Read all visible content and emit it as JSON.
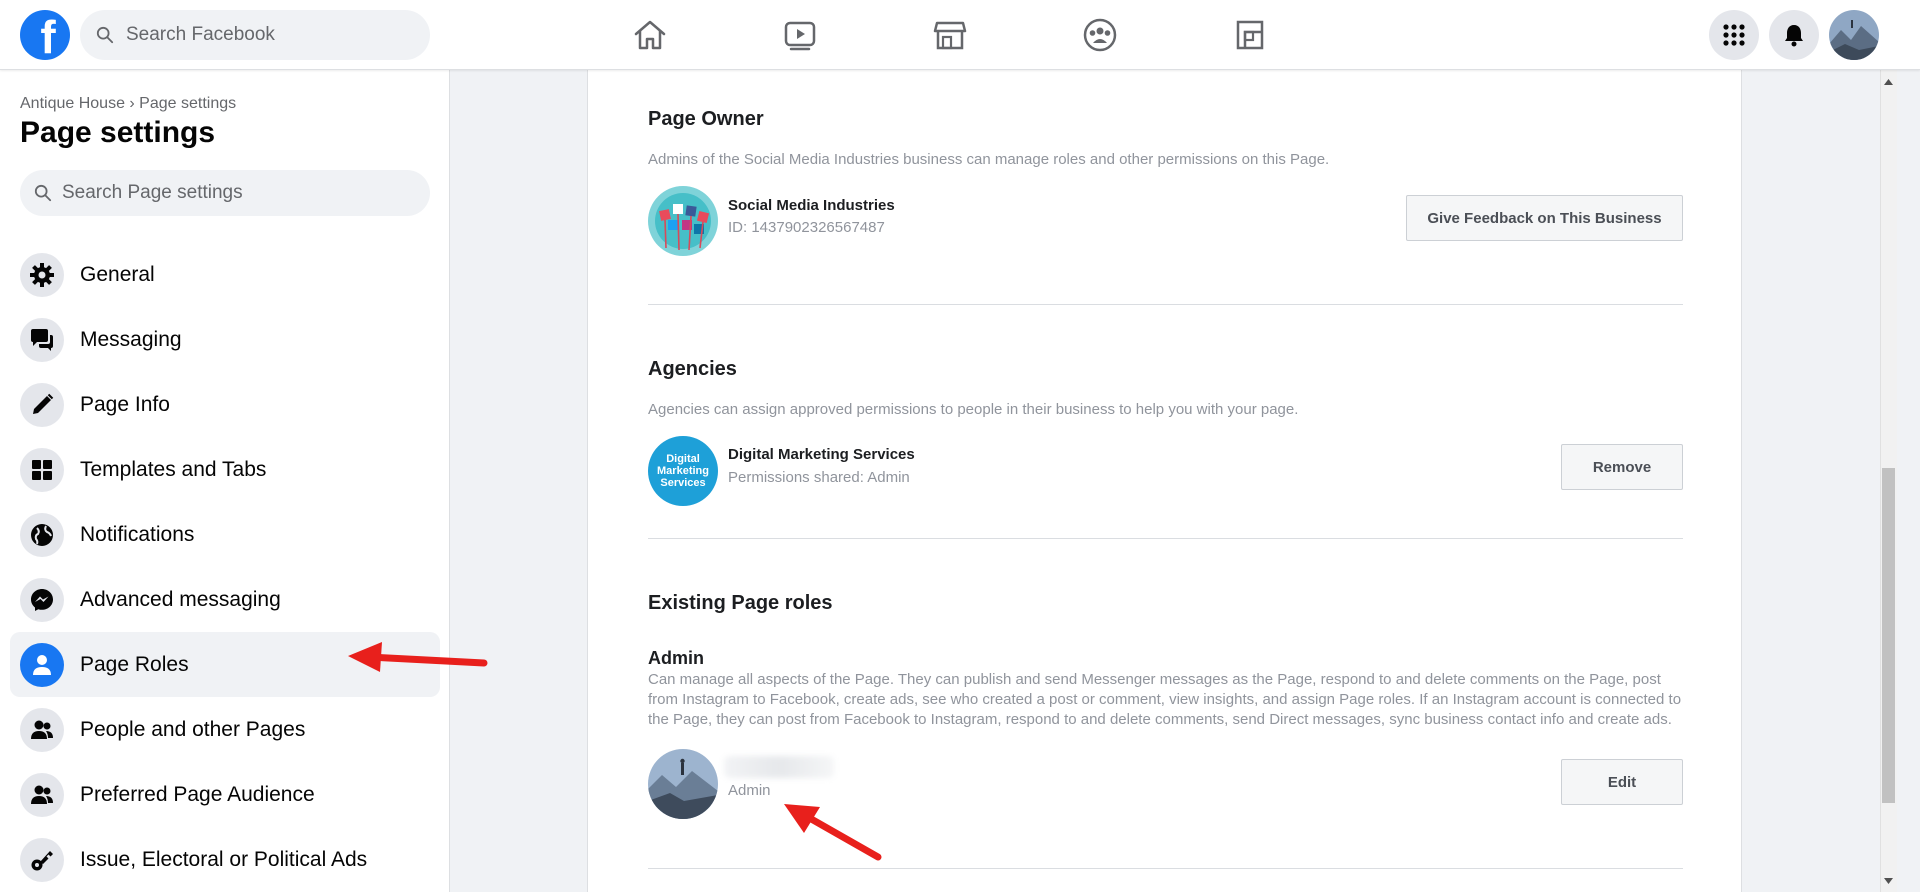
{
  "topbar": {
    "logo_letter": "f",
    "search_placeholder": "Search Facebook",
    "nav_icons": [
      "home-icon",
      "watch-icon",
      "marketplace-icon",
      "groups-icon",
      "gaming-icon"
    ],
    "right_icons": [
      "menu-grid-icon",
      "notifications-icon"
    ]
  },
  "sidebar": {
    "breadcrumb": "Antique House › Page settings",
    "title": "Page settings",
    "search_placeholder": "Search Page settings",
    "items": [
      {
        "label": "General",
        "icon": "gear-icon"
      },
      {
        "label": "Messaging",
        "icon": "chat-bubbles-icon"
      },
      {
        "label": "Page Info",
        "icon": "pencil-icon"
      },
      {
        "label": "Templates and Tabs",
        "icon": "grid-icon"
      },
      {
        "label": "Notifications",
        "icon": "globe-icon"
      },
      {
        "label": "Advanced messaging",
        "icon": "messenger-icon"
      },
      {
        "label": "Page Roles",
        "icon": "person-icon",
        "active": true
      },
      {
        "label": "People and other Pages",
        "icon": "people-icon"
      },
      {
        "label": "Preferred Page Audience",
        "icon": "people-icon"
      },
      {
        "label": "Issue, Electoral or Political Ads",
        "icon": "key-icon"
      }
    ]
  },
  "main": {
    "page_owner": {
      "title": "Page Owner",
      "description": "Admins of the Social Media Industries business can manage roles and other permissions on this Page.",
      "name": "Social Media Industries",
      "id_text": "ID: 1437902326567487",
      "button": "Give Feedback on This Business"
    },
    "agencies": {
      "title": "Agencies",
      "description": "Agencies can assign approved permissions to people in their business to help you with your page.",
      "name": "Digital Marketing Services",
      "avatar_text": "Digital Marketing Services",
      "sub": "Permissions shared: Admin",
      "button": "Remove"
    },
    "roles": {
      "title": "Existing Page roles",
      "role_title": "Admin",
      "role_description_1": "Can manage all aspects of the Page. They can publish and send Messenger messages as the Page, respond to and delete comments on the Page, post",
      "role_description_2": "from Instagram to Facebook, create ads, see who created a post or comment, view insights, and assign Page roles. If an Instagram account is connected to",
      "role_description_3": "the Page, they can post from Facebook to Instagram, respond to and delete comments, send Direct messages, sync business contact info and create ads.",
      "member_role": "Admin",
      "button": "Edit"
    }
  },
  "colors": {
    "brand": "#1877f2",
    "annotation_arrow": "#e8201c"
  }
}
